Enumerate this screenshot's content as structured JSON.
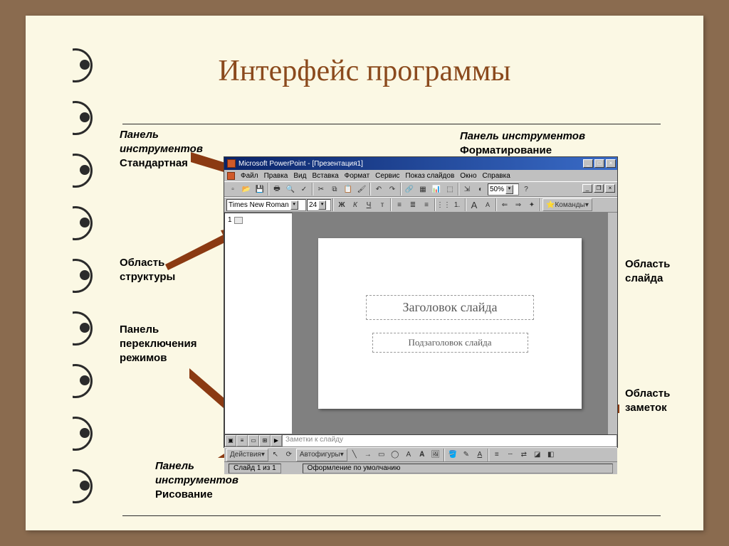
{
  "slide_title": "Интерфейс программы",
  "labels": {
    "standard_toolbar": {
      "l1": "Панель",
      "l2": "инструментов",
      "l3": "Стандартная"
    },
    "format_toolbar": {
      "l1": "Панель инструментов",
      "l2": "Форматирование"
    },
    "outline_area": {
      "l1": "Область",
      "l2": "структуры"
    },
    "slide_area": {
      "l1": "Область",
      "l2": "слайда"
    },
    "view_panel": {
      "l1": "Панель",
      "l2": "переключения",
      "l3": "режимов"
    },
    "notes_area": {
      "l1": "Область",
      "l2": "заметок"
    },
    "draw_toolbar": {
      "l1": "Панель",
      "l2": "инструментов",
      "l3": "Рисование"
    }
  },
  "pp": {
    "title": "Microsoft PowerPoint - [Презентация1]",
    "menu": [
      "Файл",
      "Правка",
      "Вид",
      "Вставка",
      "Формат",
      "Сервис",
      "Показ слайдов",
      "Окно",
      "Справка"
    ],
    "font": "Times New Roman",
    "font_size": "24",
    "zoom": "50%",
    "bold": "Ж",
    "italic": "К",
    "underline": "Ч",
    "shadow": "т",
    "commands": "Команды",
    "AA_big": "A",
    "AA_small": "A",
    "outline_index": "1",
    "ph_title": "Заголовок слайда",
    "ph_sub": "Подзаголовок слайда",
    "notes_placeholder": "Заметки к слайду",
    "draw_actions": "Действия",
    "draw_autoshapes": "Автофигуры",
    "status_slide": "Слайд 1 из 1",
    "status_template": "Оформление по умолчанию"
  }
}
